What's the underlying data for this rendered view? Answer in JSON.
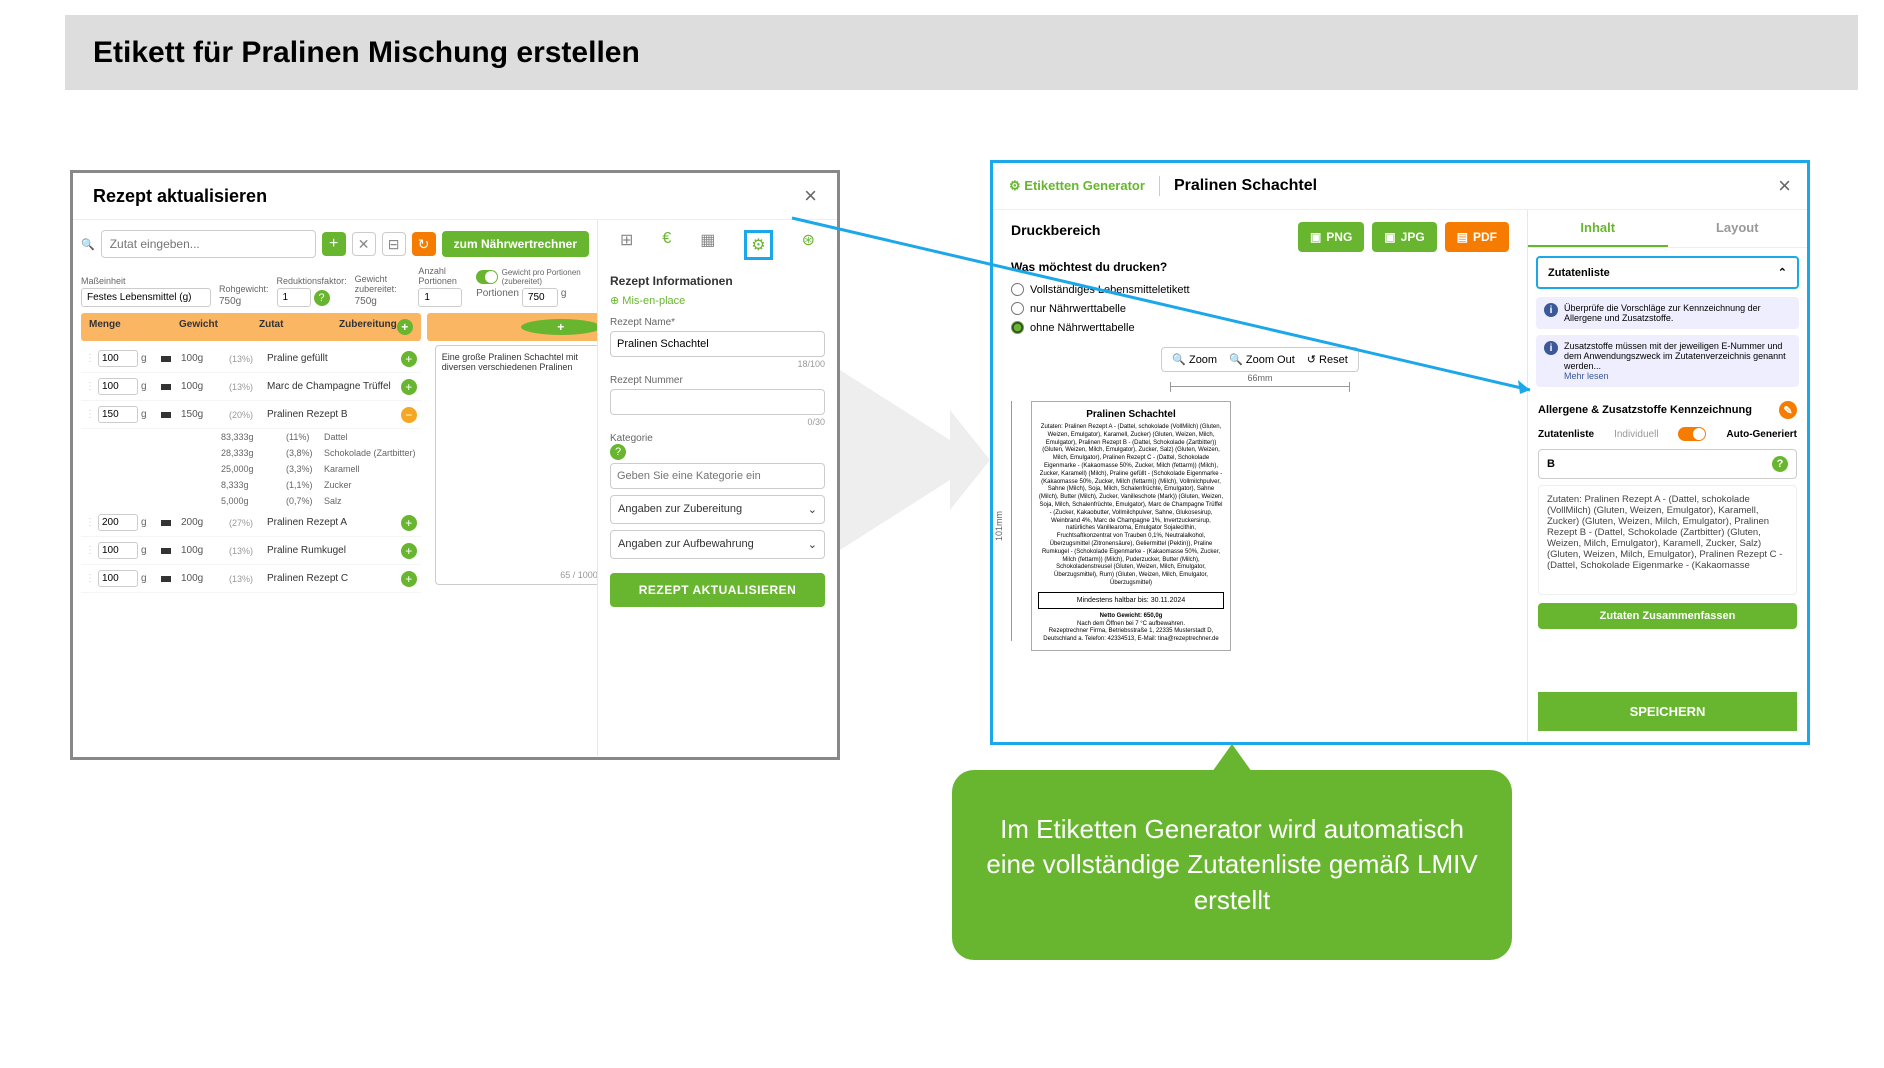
{
  "title": "Etikett für Pralinen Mischung erstellen",
  "left": {
    "heading": "Rezept aktualisieren",
    "search_placeholder": "Zutat eingeben...",
    "btn_nutrient": "zum Nährwertrechner",
    "unit_labels": {
      "mass": "Maßeinheit",
      "raw": "Rohgewicht:",
      "reduction": "Reduktionsfaktor:",
      "cooked": "Gewicht zubereitet:",
      "portions_lbl": "Anzahl Portionen",
      "per_portion_lbl": "Gewicht pro Portionen (zubereitet)",
      "portions_word": "Portionen"
    },
    "unit_values": {
      "mass": "Festes Lebensmittel (g)",
      "raw": "750g",
      "reduction": "1",
      "cooked": "750g",
      "portions": "1",
      "per_portion": "750",
      "per_portion_unit": "g"
    },
    "th": {
      "menge": "Menge",
      "gewicht": "Gewicht",
      "zutat": "Zutat",
      "zub": "Zubereitung"
    },
    "rows": [
      {
        "qty": "100",
        "u": "g",
        "w": "100g",
        "pc": "(13%)",
        "name": "Praline gefüllt",
        "btn": "plus"
      },
      {
        "qty": "100",
        "u": "g",
        "w": "100g",
        "pc": "(13%)",
        "name": "Marc de Champagne Trüffel",
        "btn": "plus"
      },
      {
        "qty": "150",
        "u": "g",
        "w": "150g",
        "pc": "(20%)",
        "name": "Pralinen Rezept B",
        "btn": "minus"
      }
    ],
    "subrows": [
      {
        "w": "83,333g",
        "pc": "(11%)",
        "name": "Dattel"
      },
      {
        "w": "28,333g",
        "pc": "(3,8%)",
        "name": "Schokolade (Zartbitter)"
      },
      {
        "w": "25,000g",
        "pc": "(3,3%)",
        "name": "Karamell"
      },
      {
        "w": "8,333g",
        "pc": "(1,1%)",
        "name": "Zucker"
      },
      {
        "w": "5,000g",
        "pc": "(0,7%)",
        "name": "Salz"
      }
    ],
    "rows2": [
      {
        "qty": "200",
        "u": "g",
        "w": "200g",
        "pc": "(27%)",
        "name": "Pralinen Rezept A",
        "btn": "plus"
      },
      {
        "qty": "100",
        "u": "g",
        "w": "100g",
        "pc": "(13%)",
        "name": "Praline Rumkugel",
        "btn": "plus"
      },
      {
        "qty": "100",
        "u": "g",
        "w": "100g",
        "pc": "(13%)",
        "name": "Pralinen Rezept C",
        "btn": "plus"
      }
    ],
    "prep_text": "Eine große Pralinen Schachtel mit diversen verschiedenen Pralinen",
    "prep_counter": "65 / 1000",
    "info": {
      "heading": "Rezept Informationen",
      "mise": "Mis-en-place",
      "name_label": "Rezept Name*",
      "name_value": "Pralinen Schachtel",
      "name_counter": "18/100",
      "number_label": "Rezept Nummer",
      "number_counter": "0/30",
      "cat_label": "Kategorie",
      "cat_placeholder": "Geben Sie eine Kategorie ein",
      "sel1": "Angaben zur Zubereitung",
      "sel2": "Angaben zur Aufbewahrung",
      "save": "REZEPT AKTUALISIEREN"
    }
  },
  "right": {
    "gen": "Etiketten Generator",
    "name": "Pralinen Schachtel",
    "fmt": {
      "png": "PNG",
      "jpg": "JPG",
      "pdf": "PDF"
    },
    "dl_head": "Druckbereich",
    "question": "Was möchtest du drucken?",
    "opts": [
      "Vollständiges Lebensmitteletikett",
      "nur Nährwerttabelle",
      "ohne Nährwerttabelle"
    ],
    "zoom": {
      "in": "Zoom",
      "out": "Zoom Out",
      "reset": "Reset"
    },
    "ruler_h": "66mm",
    "ruler_v": "101mm",
    "preview": {
      "title": "Pralinen Schachtel",
      "body": "Zutaten: Pralinen Rezept A - (Dattel, schokolade (VollMilch) (Gluten, Weizen, Emulgator), Karamell, Zucker) (Gluten, Weizen, Milch, Emulgator), Pralinen Rezept B - (Dattel, Schokolade (Zartbitter)) (Gluten, Weizen, Milch, Emulgator), Zucker, Salz) (Gluten, Weizen, Milch, Emulgator), Pralinen Rezept C - (Dattel, Schokolade Eigenmarke - (Kakaomasse 50%, Zucker, Milch (fettarm)) (Milch), Zucker, Karamell) (Milch), Praline gefüllt - (Schokolade Eigenmarke - (Kakaomasse 50%, Zucker, Milch (fettarm)) (Milch), Vollmilchpulver, Sahne (Milch), Soja, Milch, Schalenfrüchte, Emulgator), Sahne (Milch), Butter (Milch), Zucker, Vanilleschote (Mark)) (Gluten, Weizen, Soja, Milch, Schalenfrüchte, Emulgator), Marc de Champagne Trüffel - (Zucker, Kakaobutter, Vollmilchpulver, Sahne, Glukosesirup, Weinbrand 4%, Marc de Champagne 1%, Invertzuckersirup, natürliches Vanillearoma, Emulgator Sojalecithin, Fruchtsaftkonzentrat von Trauben 0,1%, Neutralalkohol, Überzugsmittel (Zitronensäure), Geliermittel (Pektin)), Praline Rumkugel - (Schokolade Eigenmarke - (Kakaomasse 50%, Zucker, Milch (fettarm)) (Milch), Puderzucker, Butter (Milch), Schokoladenstreusel (Gluten, Weizen, Milch, Emulgator, Überzugsmittel), Rum) (Gluten, Weizen, Milch, Emulgator, Überzugsmittel)",
      "mhd": "Mindestens haltbar bis: 30.11.2024",
      "netto": "Netto Gewicht: 650,0g",
      "storage": "Nach dem Öffnen bei 7 °C aufbewahren.",
      "addr": "Rezeptrechner Firma, Betriebsstraße 1, 22335 Musterstadt D, Deutschland a. Telefon: 42334513, E-Mail: tina@rezeptrechner.de"
    },
    "tabs": {
      "t1": "Inhalt",
      "t2": "Layout"
    },
    "acc_title": "Zutatenliste",
    "info1": "Überprüfe die Vorschläge zur Kennzeichnung der Allergene und Zusatzstoffe.",
    "info2": "Zusatzstoffe müssen mit der jeweiligen E-Nummer und dem Anwendungszweck im Zutatenverzeichnis genannt werden...",
    "more": "Mehr lesen",
    "alrg_head": "Allergene & Zusatzstoffe Kennzeichnung",
    "toggle": {
      "label": "Zutatenliste",
      "l": "Individuell",
      "r": "Auto-Generiert"
    },
    "b": "B",
    "zut_text": "Zutaten: Pralinen Rezept A - (Dattel, schokolade (VollMilch) (Gluten, Weizen, Emulgator), Karamell, Zucker) (Gluten, Weizen, Milch, Emulgator), Pralinen Rezept B - (Dattel, Schokolade (Zartbitter) (Gluten, Weizen, Milch, Emulgator), Karamell, Zucker, Salz) (Gluten, Weizen, Milch, Emulgator), Pralinen Rezept C - (Dattel, Schokolade Eigenmarke - (Kakaomasse",
    "summarize": "Zutaten Zusammenfassen",
    "save": "SPEICHERN"
  },
  "callout": "Im Etiketten Generator wird automatisch eine vollständige Zutatenliste gemäß LMIV erstellt"
}
